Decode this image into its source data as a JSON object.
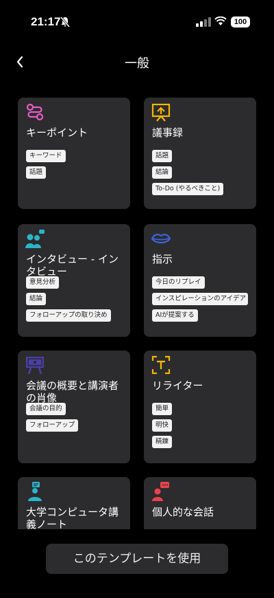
{
  "status": {
    "time": "21:17",
    "battery": "100"
  },
  "header": {
    "title": "一般"
  },
  "cards": [
    {
      "title": "キーポイント",
      "tags": [
        "キーワード",
        "話題"
      ]
    },
    {
      "title": "議事録",
      "tags": [
        "話題",
        "結論",
        "To-Do (やるべきこと)"
      ]
    },
    {
      "title": "インタビュー - インタビュー",
      "tags": [
        "意見分析",
        "結論",
        "フォローアップの取り決め"
      ]
    },
    {
      "title": "指示",
      "tags": [
        "今日のリプレイ",
        "インスピレーションのアイデア",
        "AIが提案する"
      ]
    },
    {
      "title": "会議の概要と講演者の肖像",
      "tags": [
        "会議の目的",
        "フォローアップ"
      ]
    },
    {
      "title": "リライター",
      "tags": [
        "簡単",
        "明快",
        "精錬"
      ]
    },
    {
      "title": "大学コンピュータ講義ノート",
      "tags": []
    },
    {
      "title": "個人的な会話",
      "tags": []
    }
  ],
  "footer": {
    "use_button_label": "このテンプレートを使用"
  },
  "colors": {
    "background": "#000000",
    "card": "#2c2c2e",
    "chip": "#f2f2f2"
  }
}
